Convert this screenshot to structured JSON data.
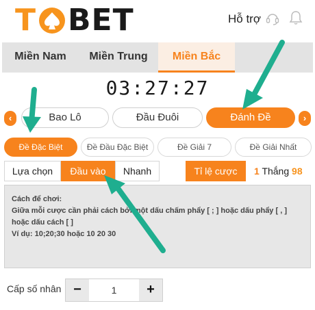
{
  "header": {
    "logo_text_left": "T",
    "logo_text_right": "BET",
    "support_label": "Hỗ trợ"
  },
  "region_tabs": [
    {
      "label": "Miền Nam",
      "active": false
    },
    {
      "label": "Miền Trung",
      "active": false
    },
    {
      "label": "Miền Bắc",
      "active": true
    }
  ],
  "timer": "03:27:27",
  "bet_types": [
    {
      "label": "Bao Lô",
      "active": false
    },
    {
      "label": "Đầu Đuôi",
      "active": false
    },
    {
      "label": "Đánh Đề",
      "active": true
    }
  ],
  "sub_types": [
    {
      "label": "Đề Đặc Biệt",
      "active": true
    },
    {
      "label": "Đề Đầu Đặc Biệt",
      "active": false
    },
    {
      "label": "Đề Giải 7",
      "active": false
    },
    {
      "label": "Đề Giải Nhất",
      "active": false
    }
  ],
  "modes": [
    {
      "label": "Lựa chọn",
      "active": false
    },
    {
      "label": "Đầu vào",
      "active": true
    },
    {
      "label": "Nhanh",
      "active": false
    }
  ],
  "rate": {
    "button_label": "Tỉ lệ cược",
    "value_left": "1",
    "unit": "Thắng",
    "value_right": "98"
  },
  "instructions": {
    "title": "Cách để chơi:",
    "line1": "Giữa mỗi cược cần phải cách bởi một dấu chấm phẩy [ ; ] hoặc dấu phẩy [ , ]",
    "line2": "hoặc dấu cách [ ]",
    "line3": "Ví dụ: 10;20;30 hoặc 10 20 30"
  },
  "multiplier": {
    "label": "Cấp số nhân",
    "minus": "−",
    "plus": "+",
    "value": "1"
  },
  "colors": {
    "accent": "#f7831d",
    "annotation": "#1fae8f"
  }
}
